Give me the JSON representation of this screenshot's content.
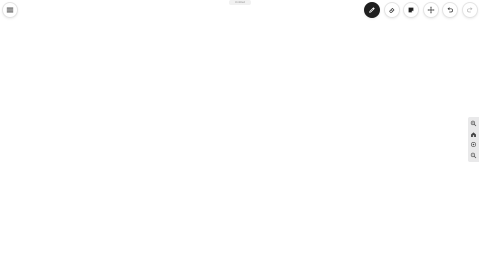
{
  "top_label": "Untitled",
  "toolbar": {
    "menu_icon": "hamburger-menu-icon",
    "tools": [
      {
        "name": "pen",
        "icon": "pen-icon",
        "active": true
      },
      {
        "name": "eraser",
        "icon": "eraser-icon",
        "active": false
      },
      {
        "name": "sticky-note",
        "icon": "sticky-note-icon",
        "active": false
      },
      {
        "name": "move",
        "icon": "move-icon",
        "active": false
      },
      {
        "name": "undo",
        "icon": "undo-icon",
        "active": false
      },
      {
        "name": "redo",
        "icon": "redo-icon",
        "active": false,
        "disabled": true
      }
    ]
  },
  "side_panel": {
    "buttons": [
      {
        "name": "zoom-in",
        "icon": "zoom-in-icon"
      },
      {
        "name": "home",
        "icon": "home-icon"
      },
      {
        "name": "reset-view",
        "icon": "target-icon"
      },
      {
        "name": "zoom-out",
        "icon": "zoom-out-icon"
      }
    ]
  },
  "colors": {
    "active_tool_bg": "#1f1f1f",
    "side_panel_bg": "#e9e9ea",
    "icon": "#333333"
  }
}
